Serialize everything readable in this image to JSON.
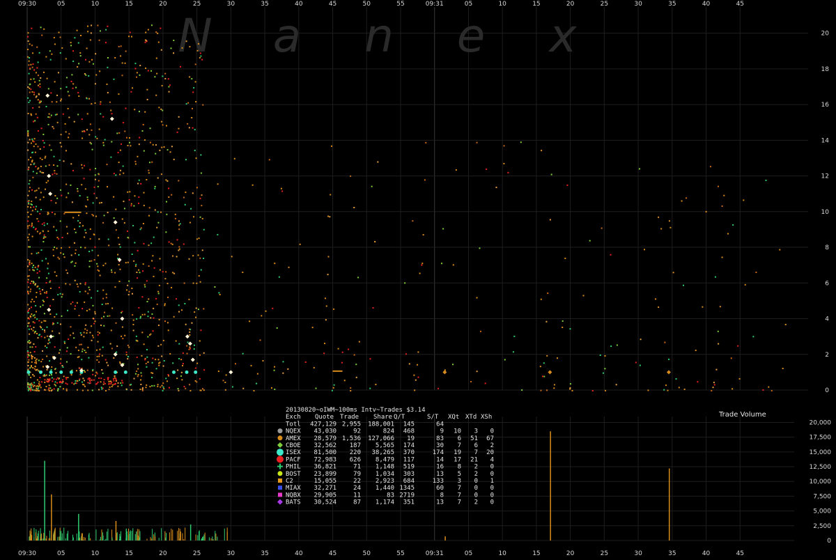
{
  "watermark": [
    "N",
    "a",
    "n",
    "e",
    "x"
  ],
  "chart_data": {
    "type": "scatter",
    "title": "20130820~oIWM~100ms Intv~Trades $3.14",
    "upper": {
      "ylim": [
        0,
        21
      ],
      "y_ticks": [
        "0",
        "2",
        "4",
        "6",
        "8",
        "10",
        "12",
        "14",
        "16",
        "18",
        "20"
      ],
      "y_tick_values": [
        0,
        2,
        4,
        6,
        8,
        10,
        12,
        14,
        16,
        18,
        20
      ]
    },
    "lower": {
      "label": "Trade Volume",
      "ylim": [
        0,
        21000
      ],
      "y_ticks": [
        "0",
        "2,500",
        "5,000",
        "7,500",
        "10,000",
        "12,500",
        "15,000",
        "17,500",
        "20,000"
      ],
      "y_tick_values": [
        0,
        2500,
        5000,
        7500,
        10000,
        12500,
        15000,
        17500,
        20000
      ],
      "bars": [
        {
          "t": 0.5,
          "v": 1500,
          "c": "#d98c1a"
        },
        {
          "t": 2.5,
          "v": 13500,
          "c": "#2ecc71"
        },
        {
          "t": 3.5,
          "v": 7800,
          "c": "#d98c1a"
        },
        {
          "t": 7.5,
          "v": 4500,
          "c": "#2ecc71"
        },
        {
          "t": 13.0,
          "v": 3300,
          "c": "#d98c1a"
        },
        {
          "t": 24.0,
          "v": 2700,
          "c": "#2ecc71"
        },
        {
          "t": 61.5,
          "v": 700,
          "c": "#d98c1a"
        },
        {
          "t": 77.0,
          "v": 18500,
          "c": "#d98c1a"
        },
        {
          "t": 94.5,
          "v": 12200,
          "c": "#d98c1a"
        }
      ]
    },
    "x_ticks_top": [
      "09:30",
      "05",
      "10",
      "15",
      "20",
      "25",
      "30",
      "35",
      "40",
      "45",
      "50",
      "55",
      "09:31",
      "05",
      "10",
      "15",
      "20",
      "25",
      "30",
      "35",
      "40",
      "45"
    ],
    "x_ticks_bottom": [
      "09:30",
      "05",
      "10",
      "15",
      "20",
      "25",
      "30",
      "35",
      "40",
      "45",
      "50",
      "55",
      "09:31",
      "05",
      "10",
      "15",
      "20",
      "25",
      "30",
      "35",
      "40",
      "45"
    ],
    "x_tick_seconds": [
      0,
      5,
      10,
      15,
      20,
      25,
      30,
      35,
      40,
      45,
      50,
      55,
      60,
      65,
      70,
      75,
      80,
      85,
      90,
      95,
      100,
      105
    ],
    "xlim": [
      0,
      114
    ],
    "table": {
      "header": [
        "Exch",
        "Quote",
        "Trade",
        "Share",
        "Q/T",
        "S/T",
        "XQt",
        "XTd",
        "XSh"
      ],
      "rows": [
        {
          "name": "Totl",
          "quote": "427,129",
          "trade": "2,955",
          "share": "188,001",
          "qt": "145",
          "st": "64",
          "xqt": "",
          "xtd": "",
          "xsh": "",
          "color": "",
          "marker": "none"
        },
        {
          "name": "NQEX",
          "quote": "43,030",
          "trade": "92",
          "share": "824",
          "qt": "468",
          "st": "9",
          "xqt": "10",
          "xtd": "3",
          "xsh": "0",
          "color": "#9a9a9a",
          "marker": "circle"
        },
        {
          "name": "AMEX",
          "quote": "28,579",
          "trade": "1,536",
          "share": "127,066",
          "qt": "19",
          "st": "83",
          "xqt": "6",
          "xtd": "51",
          "xsh": "67",
          "color": "#d98c1a",
          "marker": "circle"
        },
        {
          "name": "CBOE",
          "quote": "32,562",
          "trade": "187",
          "share": "5,565",
          "qt": "174",
          "st": "30",
          "xqt": "7",
          "xtd": "6",
          "xsh": "2",
          "color": "#7fcf3a",
          "marker": "diamond"
        },
        {
          "name": "ISEX",
          "quote": "81,500",
          "trade": "220",
          "share": "38,265",
          "qt": "370",
          "st": "174",
          "xqt": "19",
          "xtd": "7",
          "xsh": "20",
          "color": "#3ee8c8",
          "marker": "bigcircle"
        },
        {
          "name": "PACF",
          "quote": "72,983",
          "trade": "626",
          "share": "8,479",
          "qt": "117",
          "st": "14",
          "xqt": "17",
          "xtd": "21",
          "xsh": "4",
          "color": "#e82020",
          "marker": "bigcircle"
        },
        {
          "name": "PHIL",
          "quote": "36,821",
          "trade": "71",
          "share": "1,148",
          "qt": "519",
          "st": "16",
          "xqt": "8",
          "xtd": "2",
          "xsh": "0",
          "color": "#2ecc71",
          "marker": "cross"
        },
        {
          "name": "BOST",
          "quote": "23,899",
          "trade": "79",
          "share": "1,034",
          "qt": "303",
          "st": "13",
          "xqt": "5",
          "xtd": "2",
          "xsh": "0",
          "color": "#c8e81a",
          "marker": "circle"
        },
        {
          "name": "C2",
          "quote": "15,055",
          "trade": "22",
          "share": "2,923",
          "qt": "684",
          "st": "133",
          "xqt": "3",
          "xtd": "0",
          "xsh": "1",
          "color": "#e89a1a",
          "marker": "square"
        },
        {
          "name": "MIAX",
          "quote": "32,271",
          "trade": "24",
          "share": "1,440",
          "qt": "1345",
          "st": "60",
          "xqt": "7",
          "xtd": "0",
          "xsh": "0",
          "color": "#3a4ee8",
          "marker": "square"
        },
        {
          "name": "NQBX",
          "quote": "29,905",
          "trade": "11",
          "share": "83",
          "qt": "2719",
          "st": "8",
          "xqt": "7",
          "xtd": "0",
          "xsh": "0",
          "color": "#e83ac8",
          "marker": "square"
        },
        {
          "name": "BATS",
          "quote": "30,524",
          "trade": "87",
          "share": "1,174",
          "qt": "351",
          "st": "13",
          "xqt": "7",
          "xtd": "2",
          "xsh": "0",
          "color": "#a83ae8",
          "marker": "diamond"
        }
      ]
    }
  }
}
